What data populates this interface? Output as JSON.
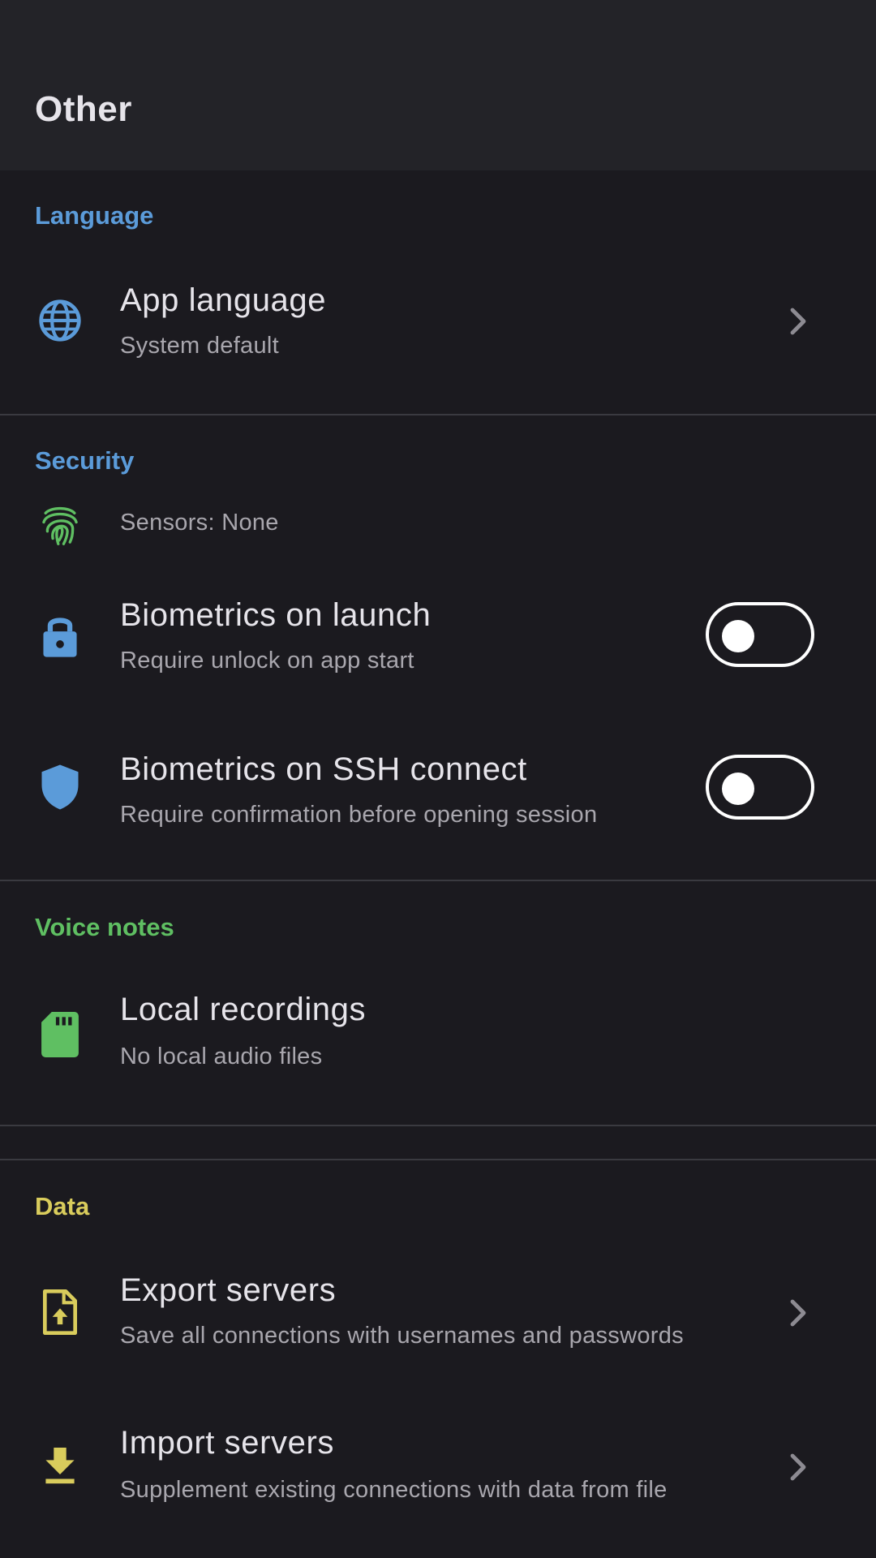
{
  "app_bar": {
    "title": "Other"
  },
  "colors": {
    "blue": "#5b9bd9",
    "green": "#5fbf62",
    "yellow": "#d9cc5c",
    "chevron": "#8d8b92"
  },
  "language": {
    "header": "Language",
    "app_language": {
      "title": "App language",
      "subtitle": "System default",
      "icon": "globe-icon"
    }
  },
  "security": {
    "header": "Security",
    "sensors": {
      "label": "Sensors: None",
      "icon": "fingerprint-icon"
    },
    "biometrics_launch": {
      "title": "Biometrics on launch",
      "subtitle": "Require unlock on app start",
      "icon": "lock-icon",
      "enabled": false
    },
    "biometrics_ssh": {
      "title": "Biometrics on SSH connect",
      "subtitle": "Require confirmation before opening session",
      "icon": "shield-icon",
      "enabled": false
    }
  },
  "voice_notes": {
    "header": "Voice notes",
    "local_recordings": {
      "title": "Local recordings",
      "subtitle": "No local audio files",
      "icon": "sd-card-icon"
    }
  },
  "data": {
    "header": "Data",
    "export_servers": {
      "title": "Export servers",
      "subtitle": "Save all connections with usernames and passwords",
      "icon": "file-upload-icon"
    },
    "import_servers": {
      "title": "Import servers",
      "subtitle": "Supplement existing connections with data from file",
      "icon": "download-icon"
    }
  }
}
